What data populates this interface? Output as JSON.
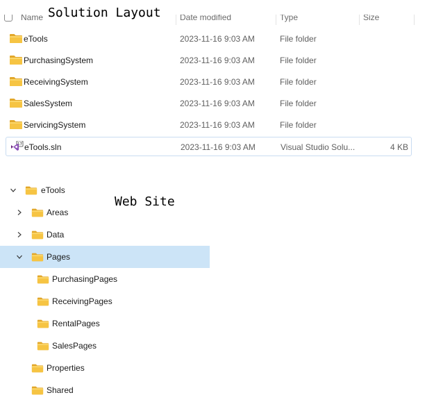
{
  "titles": {
    "solution_layout": "Solution Layout",
    "web_site": "Web Site"
  },
  "explorer": {
    "header": {
      "name": "Name",
      "date_modified": "Date modified",
      "type": "Type",
      "size": "Size"
    },
    "rows": [
      {
        "name": "eTools",
        "date": "2023-11-16 9:03 AM",
        "type": "File folder",
        "size": "",
        "icon": "folder-icon"
      },
      {
        "name": "PurchasingSystem",
        "date": "2023-11-16 9:03 AM",
        "type": "File folder",
        "size": "",
        "icon": "folder-icon"
      },
      {
        "name": "ReceivingSystem",
        "date": "2023-11-16 9:03 AM",
        "type": "File folder",
        "size": "",
        "icon": "folder-icon"
      },
      {
        "name": "SalesSystem",
        "date": "2023-11-16 9:03 AM",
        "type": "File folder",
        "size": "",
        "icon": "folder-icon"
      },
      {
        "name": "ServicingSystem",
        "date": "2023-11-16 9:03 AM",
        "type": "File folder",
        "size": "",
        "icon": "folder-icon"
      },
      {
        "name": "eTools.sln",
        "date": "2023-11-16 9:03 AM",
        "type": "Visual Studio Solu...",
        "size": "4 KB",
        "icon": "visual-studio-solution-icon"
      }
    ]
  },
  "tree": {
    "nodes": [
      {
        "label": "eTools",
        "chevron": "expanded",
        "icon": "folder-icon"
      },
      {
        "label": "Areas",
        "chevron": "collapsed",
        "icon": "folder-icon"
      },
      {
        "label": "Data",
        "chevron": "collapsed",
        "icon": "folder-icon"
      },
      {
        "label": "Pages",
        "chevron": "expanded",
        "icon": "folder-icon",
        "selected": true
      },
      {
        "label": "PurchasingPages",
        "chevron": "none",
        "icon": "folder-icon"
      },
      {
        "label": "ReceivingPages",
        "chevron": "none",
        "icon": "folder-icon"
      },
      {
        "label": "RentalPages",
        "chevron": "none",
        "icon": "folder-icon"
      },
      {
        "label": "SalesPages",
        "chevron": "none",
        "icon": "folder-icon"
      },
      {
        "label": "Properties",
        "chevron": "none",
        "icon": "folder-icon"
      },
      {
        "label": "Shared",
        "chevron": "none",
        "icon": "folder-icon"
      }
    ]
  },
  "colors": {
    "folder": "#F6C443",
    "folder_dark": "#E2A72A",
    "selected_row_border": "#C9DCF1",
    "tree_selected_bg": "#CCE4F7",
    "vs_purple": "#68217A"
  }
}
